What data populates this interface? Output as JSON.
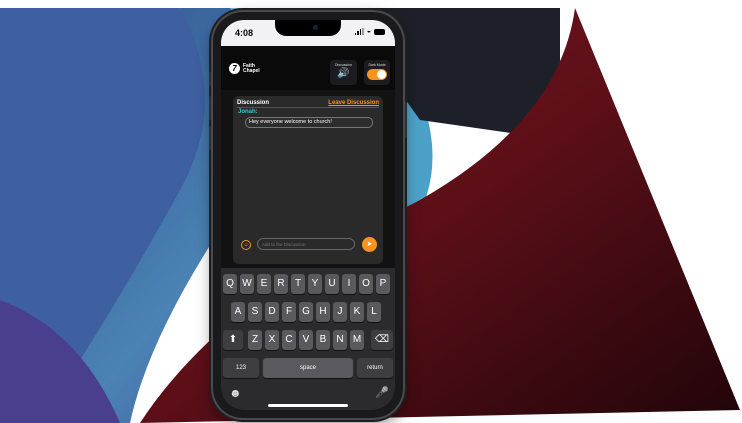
{
  "status": {
    "time": "4:08"
  },
  "header": {
    "logo_line1": "Faith",
    "logo_line2": "Chapel",
    "discussion_label": "Discussion",
    "dark_mode_label": "Dark Mode",
    "dark_mode_on": true
  },
  "discussion": {
    "title": "Discussion",
    "leave_label": "Leave Discussion",
    "messages": [
      {
        "author": "Jonah:",
        "text": "Hey everyone welcome to church!"
      }
    ],
    "input_placeholder": "Add to the Discussion"
  },
  "keyboard": {
    "row1": [
      "Q",
      "W",
      "E",
      "R",
      "T",
      "Y",
      "U",
      "I",
      "O",
      "P"
    ],
    "row2": [
      "A",
      "S",
      "D",
      "F",
      "G",
      "H",
      "J",
      "K",
      "L"
    ],
    "row3": [
      "Z",
      "X",
      "C",
      "V",
      "B",
      "N",
      "M"
    ],
    "numbers_label": "123",
    "space_label": "space",
    "return_label": "return"
  },
  "colors": {
    "accent": "#f7941d",
    "author": "#33c6dd"
  }
}
